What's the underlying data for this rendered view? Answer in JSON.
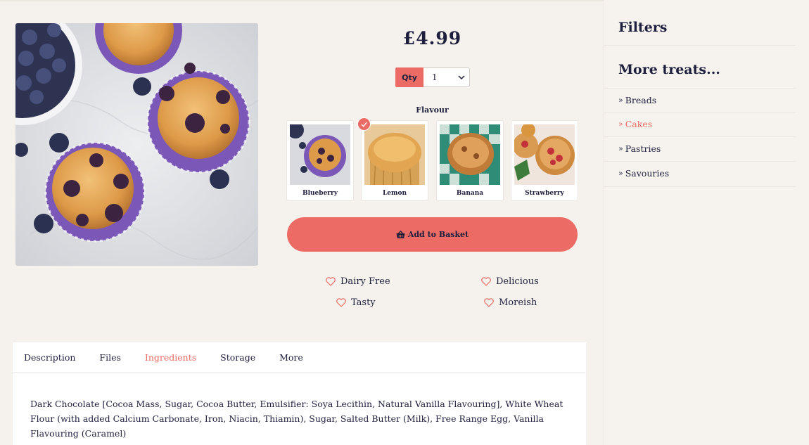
{
  "product": {
    "price": "£4.99",
    "qty_label": "Qty",
    "qty_value": "1",
    "flavour_label": "Flavour",
    "flavours": [
      {
        "name": "Blueberry",
        "selected": false
      },
      {
        "name": "Lemon",
        "selected": true
      },
      {
        "name": "Banana",
        "selected": false
      },
      {
        "name": "Strawberry",
        "selected": false
      }
    ],
    "add_to_basket": "Add to Basket",
    "features": [
      "Dairy Free",
      "Delicious",
      "Tasty",
      "Moreish"
    ]
  },
  "tabs": {
    "items": [
      "Description",
      "Files",
      "Ingredients",
      "Storage",
      "More"
    ],
    "active": "Ingredients",
    "content": "Dark Chocolate [Cocoa Mass, Sugar, Cocoa Butter, Emulsifier: Soya Lecithin, Natural Vanilla Flavouring], White Wheat Flour (with added Calcium Carbonate, Iron, Niacin, Thiamin), Sugar, Salted Butter (Milk), Free Range Egg, Vanilla Flavouring (Caramel)"
  },
  "sidebar": {
    "filters_title": "Filters",
    "more_title": "More treats...",
    "links": [
      {
        "label": "Breads",
        "active": false
      },
      {
        "label": "Cakes",
        "active": true
      },
      {
        "label": "Pastries",
        "active": false
      },
      {
        "label": "Savouries",
        "active": false
      }
    ]
  },
  "colors": {
    "accent": "#ec6b64",
    "text": "#1e1f3d",
    "background": "#f5f2ed"
  },
  "icons": [
    "basket-icon",
    "heart-icon",
    "check-icon",
    "chevron-down-icon",
    "double-chevron-right-icon"
  ]
}
